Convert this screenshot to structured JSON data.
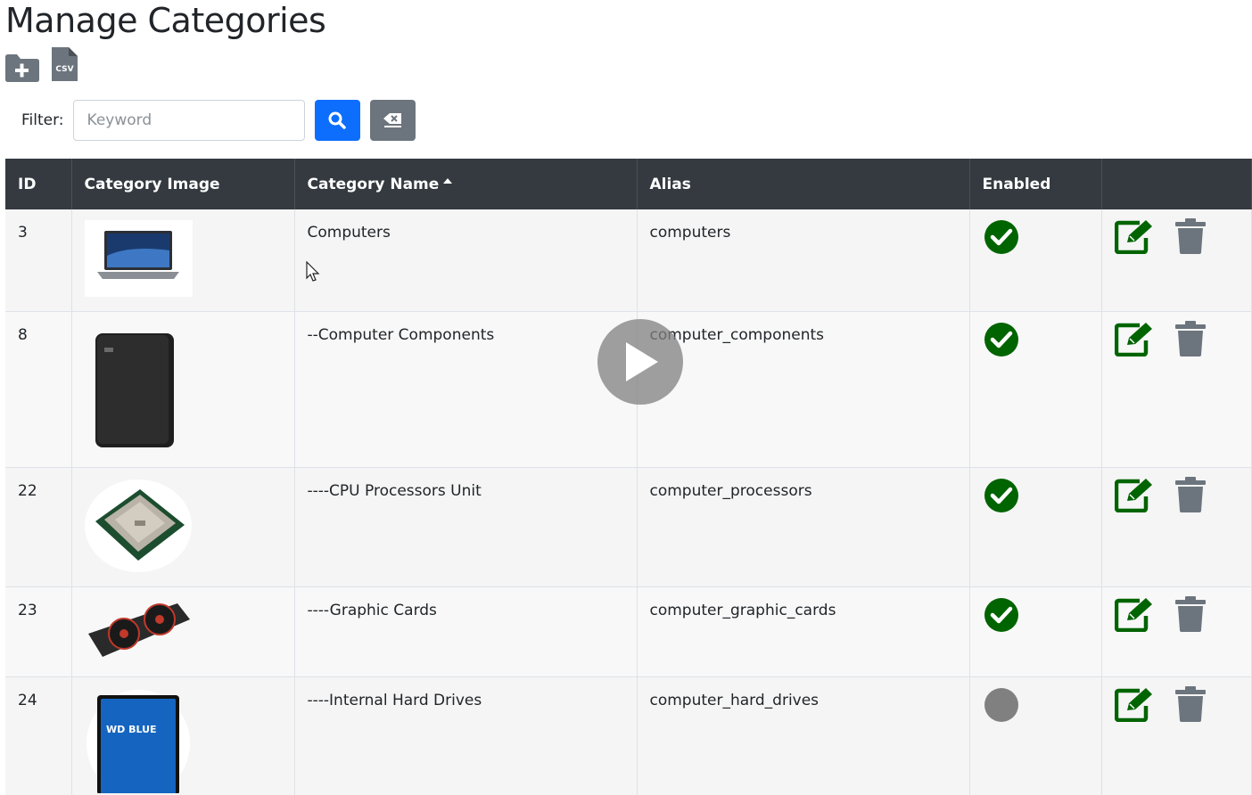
{
  "page": {
    "title": "Manage Categories"
  },
  "toolbar": {
    "new_icon": "folder-plus-icon",
    "csv_icon": "file-csv-icon",
    "csv_text": "CSV"
  },
  "filter": {
    "label": "Filter:",
    "placeholder": "Keyword",
    "value": "",
    "search_icon": "search-icon",
    "clear_icon": "eraser-icon"
  },
  "table": {
    "headers": {
      "id": "ID",
      "image": "Category Image",
      "name": "Category Name",
      "alias": "Alias",
      "enabled": "Enabled",
      "actions": ""
    },
    "sort": {
      "column": "name",
      "direction": "asc"
    },
    "rows": [
      {
        "id": "3",
        "image": "laptop",
        "name": "Computers",
        "alias": "computers",
        "enabled": true
      },
      {
        "id": "8",
        "image": "external-drive",
        "name": "--Computer Components",
        "alias": "computer_components",
        "enabled": true
      },
      {
        "id": "22",
        "image": "cpu-chip",
        "name": "----CPU Processors Unit",
        "alias": "computer_processors",
        "enabled": true
      },
      {
        "id": "23",
        "image": "graphics-card",
        "name": "----Graphic Cards",
        "alias": "computer_graphic_cards",
        "enabled": true
      },
      {
        "id": "24",
        "image": "hard-drive",
        "name": "----Internal Hard Drives",
        "alias": "computer_hard_drives",
        "enabled": false
      }
    ]
  },
  "hdd_label": {
    "brand": "WD BLUE"
  },
  "colors": {
    "header_bg": "#343a40",
    "enabled_green": "#006400",
    "disabled_gray": "#808080",
    "edit_green": "#006400",
    "delete_gray": "#6c757d",
    "search_blue": "#0d6efd"
  },
  "overlay": {
    "icon": "play-icon"
  }
}
